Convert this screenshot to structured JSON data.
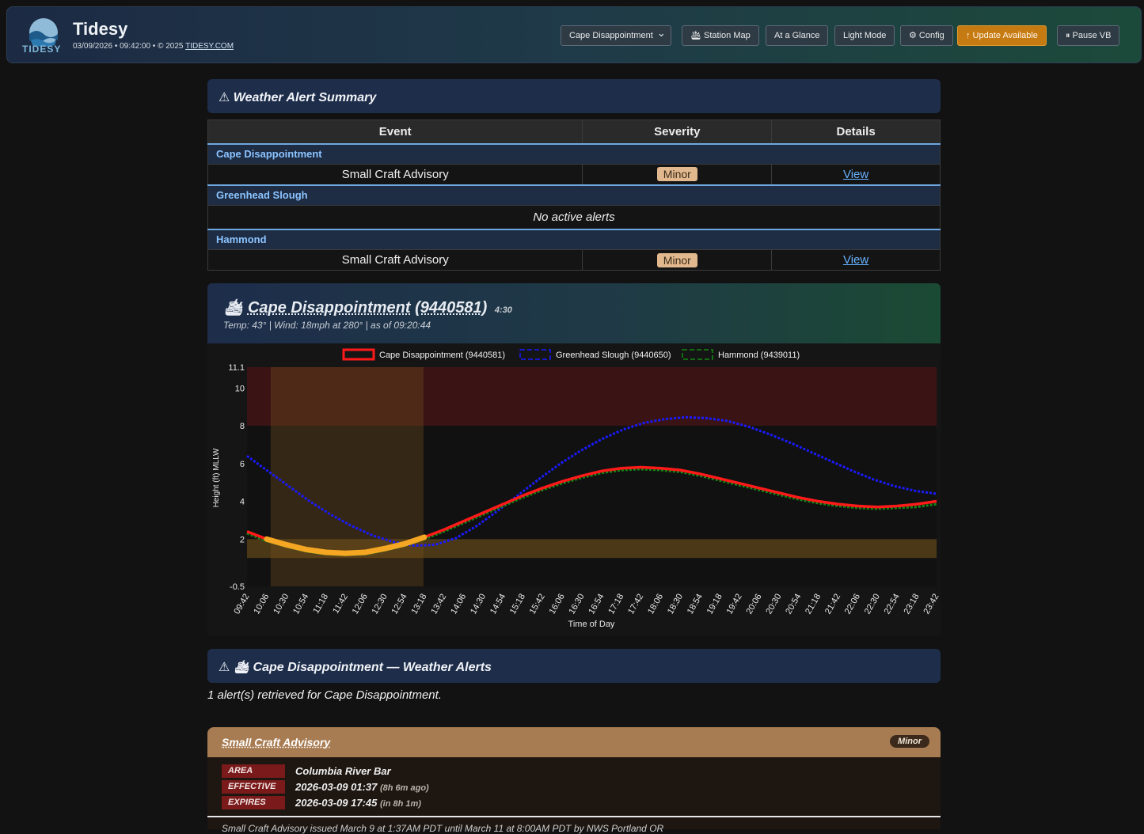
{
  "header": {
    "logo_text": "TIDESY",
    "title": "Tidesy",
    "subtitle_prefix": "03/09/2026 • 09:42:00 • © 2025",
    "subtitle_link": "TIDESY.COM",
    "station_select": "Cape Disappointment",
    "buttons": {
      "station_map": "🛳 Station Map",
      "at_a_glance": "At a Glance",
      "light_mode": "Light Mode",
      "config": "⚙ Config",
      "update": "↑ Update Available",
      "pause": "⏸ Pause VB"
    }
  },
  "summary": {
    "title": "⚠ Weather Alert Summary",
    "columns": [
      "Event",
      "Severity",
      "Details"
    ],
    "groups": [
      {
        "station": "Cape Disappointment",
        "event": "Small Craft Advisory",
        "severity": "Minor",
        "details": "View"
      },
      {
        "station": "Greenhead Slough",
        "no_alerts": "No active alerts"
      },
      {
        "station": "Hammond",
        "event": "Small Craft Advisory",
        "severity": "Minor",
        "details": "View"
      }
    ]
  },
  "station": {
    "icon": "🛳",
    "name": "Cape Disappointment",
    "id": "(9440581)",
    "time": "4:30",
    "meta": "Temp: 43°  |  Wind: 18mph at 280°  |  as of 09:20:44"
  },
  "chart_data": {
    "type": "line",
    "xlabel": "Time of Day",
    "ylabel": "Height (ft) MLLW",
    "ylim": [
      -0.5,
      11.1
    ],
    "yticks": [
      -0.5,
      2,
      4,
      6,
      8,
      10,
      11.1
    ],
    "x": [
      "09:42",
      "10:06",
      "10:30",
      "10:54",
      "11:18",
      "11:42",
      "12:06",
      "12:30",
      "12:54",
      "13:18",
      "13:42",
      "14:06",
      "14:30",
      "14:54",
      "15:18",
      "15:42",
      "16:06",
      "16:30",
      "16:54",
      "17:18",
      "17:42",
      "18:06",
      "18:30",
      "18:54",
      "19:18",
      "19:42",
      "20:06",
      "20:30",
      "20:54",
      "21:18",
      "21:42",
      "22:06",
      "22:30",
      "22:54",
      "23:18",
      "23:42"
    ],
    "series": [
      {
        "name": "Cape Disappointment (9440581)",
        "color": "#ff1a1a",
        "style": "solid",
        "values": [
          2.4,
          2.0,
          1.7,
          1.45,
          1.3,
          1.25,
          1.3,
          1.5,
          1.75,
          2.1,
          2.5,
          2.95,
          3.4,
          3.85,
          4.3,
          4.7,
          5.05,
          5.35,
          5.6,
          5.75,
          5.8,
          5.75,
          5.65,
          5.45,
          5.2,
          4.95,
          4.7,
          4.45,
          4.2,
          4.0,
          3.85,
          3.75,
          3.7,
          3.75,
          3.85,
          4.0
        ]
      },
      {
        "name": "Greenhead Slough (9440650)",
        "color": "#1a1aff",
        "style": "dashed",
        "values": [
          6.4,
          5.6,
          4.8,
          4.0,
          3.3,
          2.7,
          2.2,
          1.85,
          1.65,
          1.7,
          2.05,
          2.7,
          3.5,
          4.35,
          5.2,
          6.0,
          6.7,
          7.3,
          7.8,
          8.15,
          8.35,
          8.45,
          8.4,
          8.25,
          7.95,
          7.55,
          7.1,
          6.6,
          6.1,
          5.6,
          5.15,
          4.8,
          4.55,
          4.4
        ]
      },
      {
        "name": "Hammond (9439011)",
        "color": "#138a13",
        "style": "dashed",
        "values": [
          2.3,
          1.9,
          1.6,
          1.35,
          1.2,
          1.15,
          1.2,
          1.4,
          1.65,
          2.0,
          2.4,
          2.85,
          3.3,
          3.75,
          4.2,
          4.6,
          4.95,
          5.25,
          5.5,
          5.65,
          5.7,
          5.65,
          5.55,
          5.35,
          5.1,
          4.85,
          4.6,
          4.35,
          4.1,
          3.9,
          3.75,
          3.65,
          3.6,
          3.65,
          3.7,
          3.85
        ]
      }
    ],
    "bands": {
      "high_zone": [
        8,
        11.1
      ],
      "low_zone": [
        1,
        2
      ],
      "highlight_window": [
        "10:06",
        "13:18"
      ]
    },
    "colors": {
      "high_zone": "#3a1414",
      "low_zone": "#4a3816",
      "highlight": "#f5a623"
    }
  },
  "alerts": {
    "section_title": "⚠ 🛳 Cape Disappointment — Weather Alerts",
    "count_text": "1 alert(s) retrieved for Cape Disappointment.",
    "card": {
      "title": "Small Craft Advisory",
      "badge": "Minor",
      "area_label": "AREA",
      "area": "Columbia River Bar",
      "effective_label": "EFFECTIVE",
      "effective": "2026-03-09 01:37",
      "effective_rel": "(8h 6m ago)",
      "expires_label": "EXPIRES",
      "expires": "2026-03-09 17:45",
      "expires_rel": "(in 8h 1m)",
      "description": "Small Craft Advisory issued March 9 at 1:37AM PDT until March 11 at 8:00AM PDT by NWS Portland OR"
    }
  }
}
